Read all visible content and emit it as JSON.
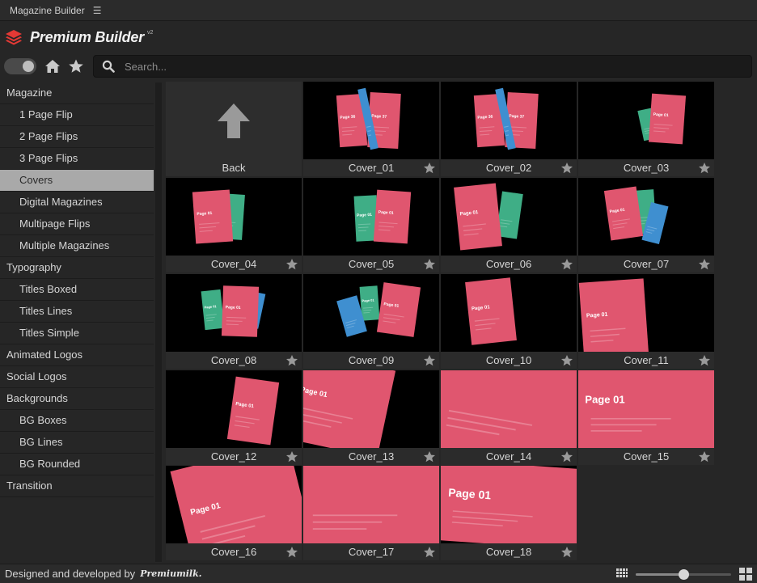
{
  "window": {
    "title": "Magazine Builder"
  },
  "header": {
    "brand": "Premium Builder",
    "version": "v2"
  },
  "search": {
    "placeholder": "Search..."
  },
  "sidebar": {
    "items": [
      {
        "label": "Magazine",
        "level": "cat"
      },
      {
        "label": "1 Page Flip",
        "level": "sub"
      },
      {
        "label": "2 Page Flips",
        "level": "sub"
      },
      {
        "label": "3 Page Flips",
        "level": "sub"
      },
      {
        "label": "Covers",
        "level": "sub",
        "active": true
      },
      {
        "label": "Digital Magazines",
        "level": "sub"
      },
      {
        "label": "Multipage Flips",
        "level": "sub"
      },
      {
        "label": "Multiple Magazines",
        "level": "sub"
      },
      {
        "label": "Typography",
        "level": "cat"
      },
      {
        "label": "Titles Boxed",
        "level": "sub"
      },
      {
        "label": "Titles Lines",
        "level": "sub"
      },
      {
        "label": "Titles Simple",
        "level": "sub"
      },
      {
        "label": "Animated Logos",
        "level": "cat"
      },
      {
        "label": "Social Logos",
        "level": "cat"
      },
      {
        "label": "Backgrounds",
        "level": "cat"
      },
      {
        "label": "BG Boxes",
        "level": "sub"
      },
      {
        "label": "BG Lines",
        "level": "sub"
      },
      {
        "label": "BG Rounded",
        "level": "sub"
      },
      {
        "label": "Transition",
        "level": "cat"
      }
    ]
  },
  "grid": {
    "back_label": "Back",
    "tiles": [
      {
        "label": "Cover_01",
        "thumb": "flip",
        "pages": [
          "Page 36",
          "Page 37"
        ]
      },
      {
        "label": "Cover_02",
        "thumb": "flip",
        "pages": [
          "Page 36",
          "Page 37"
        ]
      },
      {
        "label": "Cover_03",
        "thumb": "pair-small",
        "pages": [
          "Page 01"
        ]
      },
      {
        "label": "Cover_04",
        "thumb": "pair-left",
        "pages": [
          "Page 01"
        ]
      },
      {
        "label": "Cover_05",
        "thumb": "pair-center",
        "pages": [
          "Page 01",
          "Page 01"
        ]
      },
      {
        "label": "Cover_06",
        "thumb": "pair-large",
        "pages": [
          "Page 01"
        ]
      },
      {
        "label": "Cover_07",
        "thumb": "triple-right",
        "pages": [
          "Page 01"
        ]
      },
      {
        "label": "Cover_08",
        "thumb": "triple-fan",
        "pages": [
          "Page 01",
          "Page 01"
        ]
      },
      {
        "label": "Cover_09",
        "thumb": "triple-tilt",
        "pages": [
          "Page 01",
          "Page 01"
        ]
      },
      {
        "label": "Cover_10",
        "thumb": "single",
        "pages": [
          "Page 01"
        ]
      },
      {
        "label": "Cover_11",
        "thumb": "single-large",
        "pages": [
          "Page 01"
        ]
      },
      {
        "label": "Cover_12",
        "thumb": "single-right",
        "pages": [
          "Page 01"
        ]
      },
      {
        "label": "Cover_13",
        "thumb": "zoom-1",
        "pages": [
          "Page 01"
        ]
      },
      {
        "label": "Cover_14",
        "thumb": "zoom-2",
        "pages": []
      },
      {
        "label": "Cover_15",
        "thumb": "zoom-3",
        "pages": [
          "Page 01"
        ]
      },
      {
        "label": "Cover_16",
        "thumb": "zoom-4",
        "pages": [
          "Page 01"
        ]
      },
      {
        "label": "Cover_17",
        "thumb": "zoom-5",
        "pages": []
      },
      {
        "label": "Cover_18",
        "thumb": "zoom-6",
        "pages": [
          "Page 01"
        ]
      }
    ]
  },
  "footer": {
    "credit": "Designed and developed by",
    "brandmark": "Premiumilk.",
    "zoom": 0.5
  },
  "colors": {
    "page_pink": "#e0566f",
    "page_teal": "#3fae86",
    "page_blue": "#3f8fd0",
    "logo_red": "#e53935",
    "accent_gray": "#a9a9a9"
  }
}
